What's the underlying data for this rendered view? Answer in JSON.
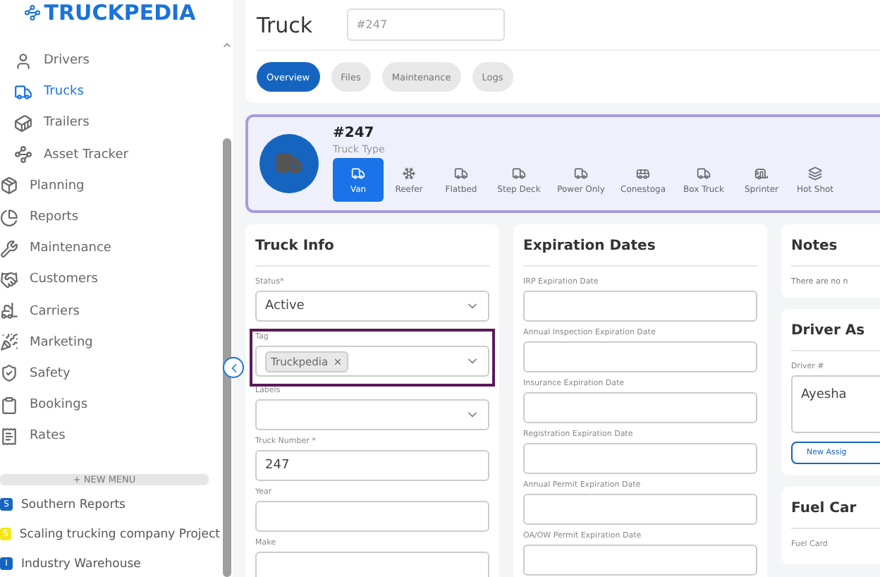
{
  "logo": {
    "text": "TRUCKPEDIA"
  },
  "sidebar": {
    "sub_items": [
      {
        "label": "Drivers",
        "selected": false
      },
      {
        "label": "Trucks",
        "selected": true
      },
      {
        "label": "Trailers",
        "selected": false
      },
      {
        "label": "Asset Tracker",
        "selected": false
      }
    ],
    "items": [
      {
        "label": "Planning",
        "selected": false
      },
      {
        "label": "Reports",
        "selected": false
      },
      {
        "label": "Maintenance",
        "selected": false
      },
      {
        "label": "Customers",
        "selected": false
      },
      {
        "label": "Carriers",
        "selected": false
      },
      {
        "label": "Marketing",
        "selected": false
      },
      {
        "label": "Safety",
        "selected": false
      },
      {
        "label": "Bookings",
        "selected": false
      },
      {
        "label": "Rates",
        "selected": false
      }
    ],
    "new_menu": {
      "icon": "+",
      "label": "NEW MENU"
    },
    "projects": [
      {
        "badge": "S",
        "label": "Southern Reports",
        "color": "#1565c0"
      },
      {
        "badge": "S",
        "label": "Scaling trucking company Project",
        "color": "#f5e716"
      },
      {
        "badge": "I",
        "label": "Industry Warehouse",
        "color": "#1565c0"
      }
    ]
  },
  "header": {
    "title": "Truck",
    "number_field": {
      "placeholder": "#247"
    },
    "tabs": [
      {
        "label": "Overview",
        "selected": true
      },
      {
        "label": "Files",
        "selected": false
      },
      {
        "label": "Maintenance",
        "selected": false
      },
      {
        "label": "Logs",
        "selected": false
      }
    ]
  },
  "truck_card": {
    "number": "#247",
    "type_label": "Truck Type",
    "types": [
      {
        "label": "Van",
        "selected": true
      },
      {
        "label": "Reefer",
        "selected": false
      },
      {
        "label": "Flatbed",
        "selected": false
      },
      {
        "label": "Step Deck",
        "selected": false
      },
      {
        "label": "Power Only",
        "selected": false
      },
      {
        "label": "Conestoga",
        "selected": false
      },
      {
        "label": "Box Truck",
        "selected": false
      },
      {
        "label": "Sprinter",
        "selected": false
      },
      {
        "label": "Hot Shot",
        "selected": false
      }
    ]
  },
  "truck_info": {
    "title": "Truck Info",
    "fields": [
      {
        "kind": "select",
        "label": "Status*",
        "value": "Active"
      },
      {
        "kind": "tags",
        "label": "Tag",
        "tags": [
          "Truckpedia"
        ],
        "highlighted": true
      },
      {
        "kind": "select",
        "label": "Labels"
      },
      {
        "kind": "text",
        "label": "Truck Number *",
        "value": "247"
      },
      {
        "kind": "text",
        "label": "Year"
      },
      {
        "kind": "text",
        "label": "Make"
      }
    ]
  },
  "expiration_dates": {
    "title": "Expiration Dates",
    "fields": [
      {
        "label": "IRP Expiration Date"
      },
      {
        "label": "Annual Inspection Expiration Date"
      },
      {
        "label": "Insurance Expiration Date"
      },
      {
        "label": "Registration Expiration Date"
      },
      {
        "label": "Annual Permit Expiration Date"
      },
      {
        "label": "OA/OW Permit Expiration Date"
      }
    ]
  },
  "notes": {
    "title": "Notes",
    "text": "There are no n"
  },
  "driver_assignment": {
    "title": "Driver As",
    "field_label": "Driver #",
    "value": "Ayesha",
    "button": "New Assig"
  },
  "fuel_card": {
    "title": "Fuel Car",
    "field_label": "Fuel Card"
  }
}
